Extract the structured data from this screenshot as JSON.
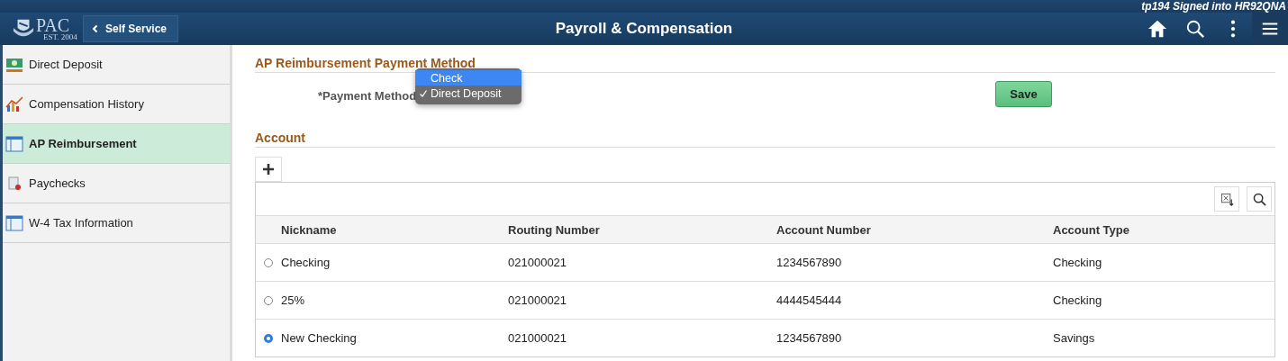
{
  "signed_in": "tp194 Signed into HR92QNA",
  "header": {
    "logo_text": "PAC",
    "logo_sub": "EST. 2004",
    "back_label": "Self Service",
    "title": "Payroll & Compensation"
  },
  "sidebar": {
    "items": [
      {
        "label": "Direct Deposit",
        "kind": "money",
        "selected": false
      },
      {
        "label": "Compensation History",
        "kind": "chart",
        "selected": false
      },
      {
        "label": "AP Reimbursement",
        "kind": "window",
        "selected": true
      },
      {
        "label": "Paychecks",
        "kind": "document",
        "selected": false
      },
      {
        "label": "W-4 Tax Information",
        "kind": "window",
        "selected": false
      }
    ]
  },
  "payment_section": {
    "title": "AP Reimbursement Payment Method",
    "field_label": "*Payment Method",
    "options": [
      {
        "label": "Check",
        "highlighted": true,
        "selected": false
      },
      {
        "label": "Direct Deposit",
        "highlighted": false,
        "selected": true
      }
    ],
    "save_button": "Save"
  },
  "account_section": {
    "title": "Account",
    "table": {
      "columns": [
        "Nickname",
        "Routing Number",
        "Account Number",
        "Account Type"
      ],
      "rows": [
        {
          "selected": false,
          "cells": [
            "Checking",
            "021000021",
            "1234567890",
            "Checking"
          ]
        },
        {
          "selected": false,
          "cells": [
            "25%",
            "021000021",
            "4444545444",
            "Checking"
          ]
        },
        {
          "selected": true,
          "cells": [
            "New Checking",
            "021000021",
            "1234567890",
            "Savings"
          ]
        }
      ]
    }
  }
}
